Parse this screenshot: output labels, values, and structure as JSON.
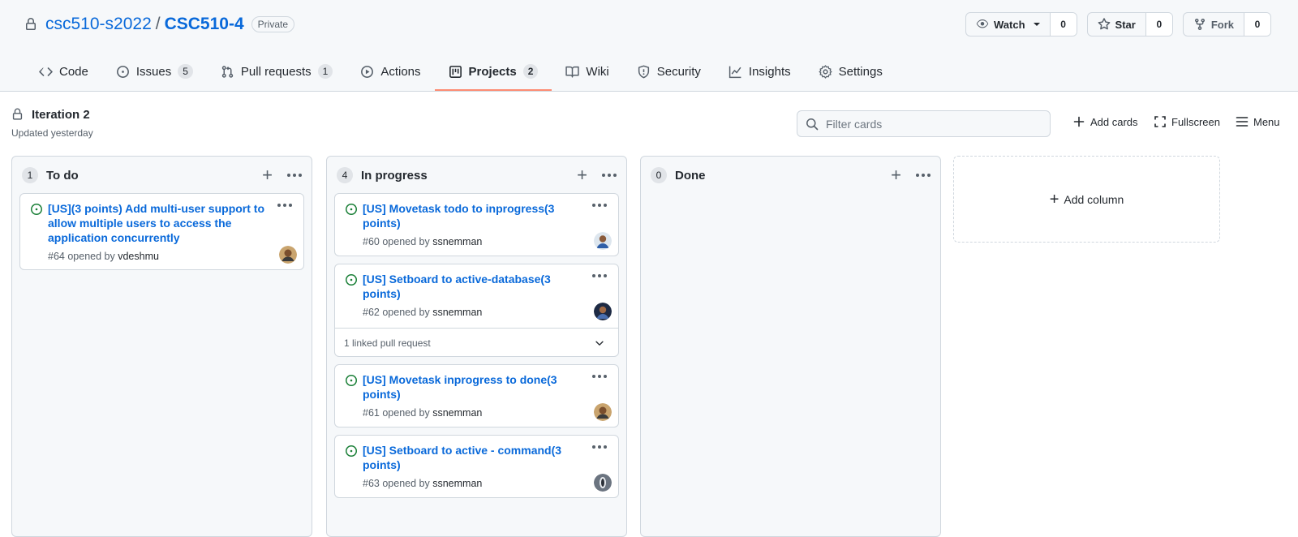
{
  "repo": {
    "owner": "csc510-s2022",
    "separator": "/",
    "name": "CSC510-4",
    "visibility": "Private",
    "watch": {
      "label": "Watch",
      "count": "0"
    },
    "star": {
      "label": "Star",
      "count": "0"
    },
    "fork": {
      "label": "Fork",
      "count": "0"
    }
  },
  "tabs": [
    {
      "label": "Code",
      "icon": "code-icon"
    },
    {
      "label": "Issues",
      "icon": "issue-icon",
      "counter": "5"
    },
    {
      "label": "Pull requests",
      "icon": "pull-request-icon",
      "counter": "1"
    },
    {
      "label": "Actions",
      "icon": "play-icon"
    },
    {
      "label": "Projects",
      "icon": "project-icon",
      "counter": "2",
      "selected": true
    },
    {
      "label": "Wiki",
      "icon": "book-icon"
    },
    {
      "label": "Security",
      "icon": "shield-icon"
    },
    {
      "label": "Insights",
      "icon": "graph-icon"
    },
    {
      "label": "Settings",
      "icon": "gear-icon"
    }
  ],
  "project": {
    "title": "Iteration 2",
    "updated": "Updated yesterday",
    "filter_placeholder": "Filter cards",
    "add_cards": "Add cards",
    "fullscreen": "Fullscreen",
    "menu": "Menu",
    "add_column": "Add column"
  },
  "columns": [
    {
      "name": "To do",
      "count": "1",
      "cards": [
        {
          "title": "[US](3 points) Add multi-user support to allow multiple users to access the application concurrently",
          "number": "#64",
          "opened_by_text": "opened by",
          "author": "vdeshmu"
        }
      ]
    },
    {
      "name": "In progress",
      "count": "4",
      "cards": [
        {
          "title": "[US] Movetask todo to inprogress(3 points)",
          "number": "#60",
          "opened_by_text": "opened by",
          "author": "ssnemman"
        },
        {
          "title": "[US] Setboard to active-database(3 points)",
          "number": "#62",
          "opened_by_text": "opened by",
          "author": "ssnemman",
          "linked": "1 linked pull request"
        },
        {
          "title": "[US] Movetask inprogress to done(3 points)",
          "number": "#61",
          "opened_by_text": "opened by",
          "author": "ssnemman"
        },
        {
          "title": "[US] Setboard to active - command(3 points)",
          "number": "#63",
          "opened_by_text": "opened by",
          "author": "ssnemman"
        }
      ]
    },
    {
      "name": "Done",
      "count": "0",
      "cards": []
    }
  ],
  "colors": {
    "link": "#0969da",
    "open_state": "#1a7f37",
    "tab_underline": "#fd8c73"
  }
}
